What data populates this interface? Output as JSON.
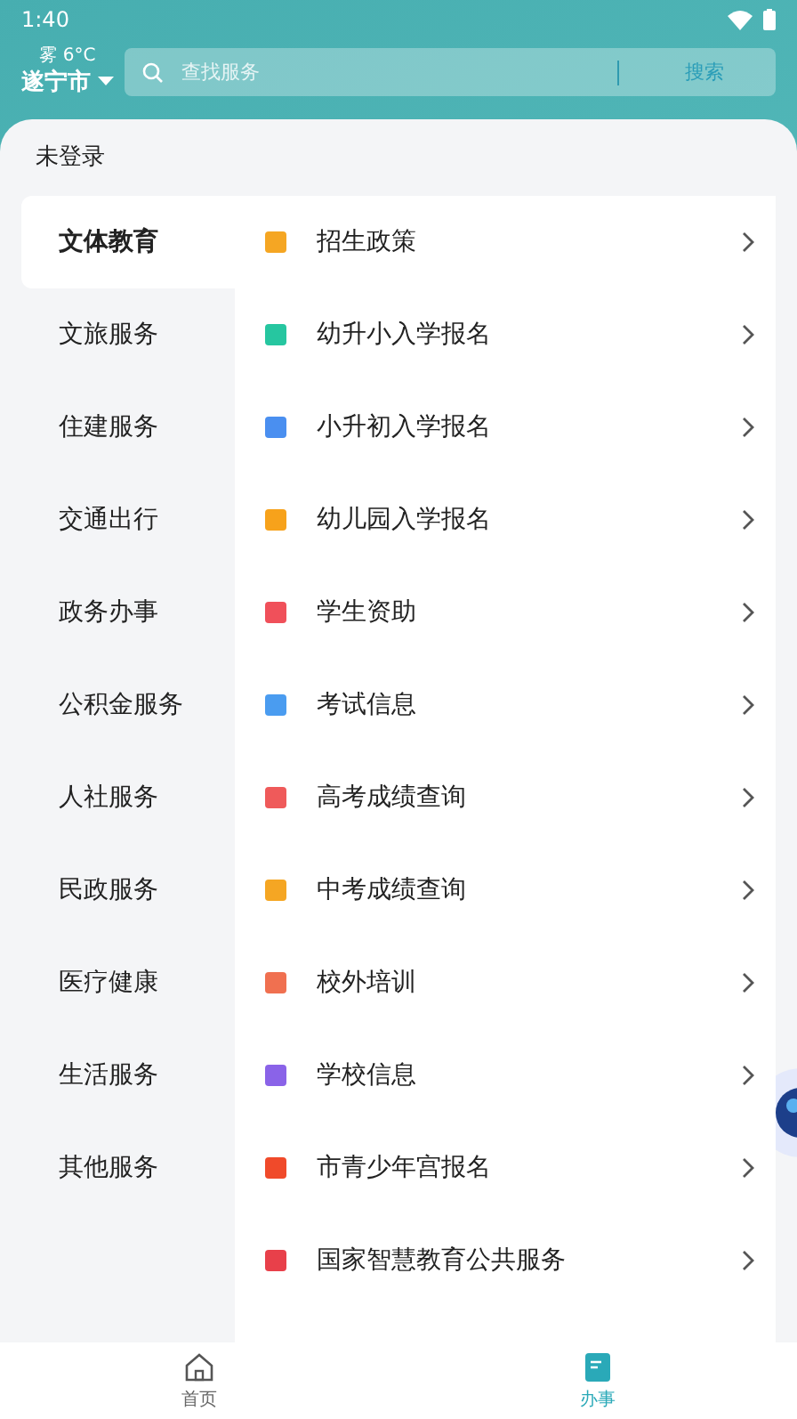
{
  "status_bar": {
    "time": "1:40"
  },
  "header": {
    "weather": "雾 6°C",
    "city": "遂宁市",
    "search": {
      "placeholder": "查找服务",
      "button": "搜索"
    }
  },
  "login_status": "未登录",
  "categories": [
    {
      "label": "文体教育",
      "selected": true
    },
    {
      "label": "文旅服务",
      "selected": false
    },
    {
      "label": "住建服务",
      "selected": false
    },
    {
      "label": "交通出行",
      "selected": false
    },
    {
      "label": "政务办事",
      "selected": false
    },
    {
      "label": "公积金服务",
      "selected": false
    },
    {
      "label": "人社服务",
      "selected": false
    },
    {
      "label": "民政服务",
      "selected": false
    },
    {
      "label": "医疗健康",
      "selected": false
    },
    {
      "label": "生活服务",
      "selected": false
    },
    {
      "label": "其他服务",
      "selected": false
    }
  ],
  "services": [
    {
      "label": "招生政策",
      "color": "#f5a623"
    },
    {
      "label": "幼升小入学报名",
      "color": "#26c6a0"
    },
    {
      "label": "小升初入学报名",
      "color": "#4a8ff0"
    },
    {
      "label": "幼儿园入学报名",
      "color": "#f7a21b"
    },
    {
      "label": "学生资助",
      "color": "#f0505a"
    },
    {
      "label": "考试信息",
      "color": "#4a9cf0"
    },
    {
      "label": "高考成绩查询",
      "color": "#ef5a5a"
    },
    {
      "label": "中考成绩查询",
      "color": "#f5a623"
    },
    {
      "label": "校外培训",
      "color": "#f07050"
    },
    {
      "label": "学校信息",
      "color": "#8a63e8"
    },
    {
      "label": "市青少年宫报名",
      "color": "#f04a2a"
    },
    {
      "label": "国家智慧教育公共服务",
      "color": "#e8404a"
    }
  ],
  "bottom_nav": [
    {
      "label": "首页",
      "selected": false
    },
    {
      "label": "办事",
      "selected": true
    }
  ]
}
